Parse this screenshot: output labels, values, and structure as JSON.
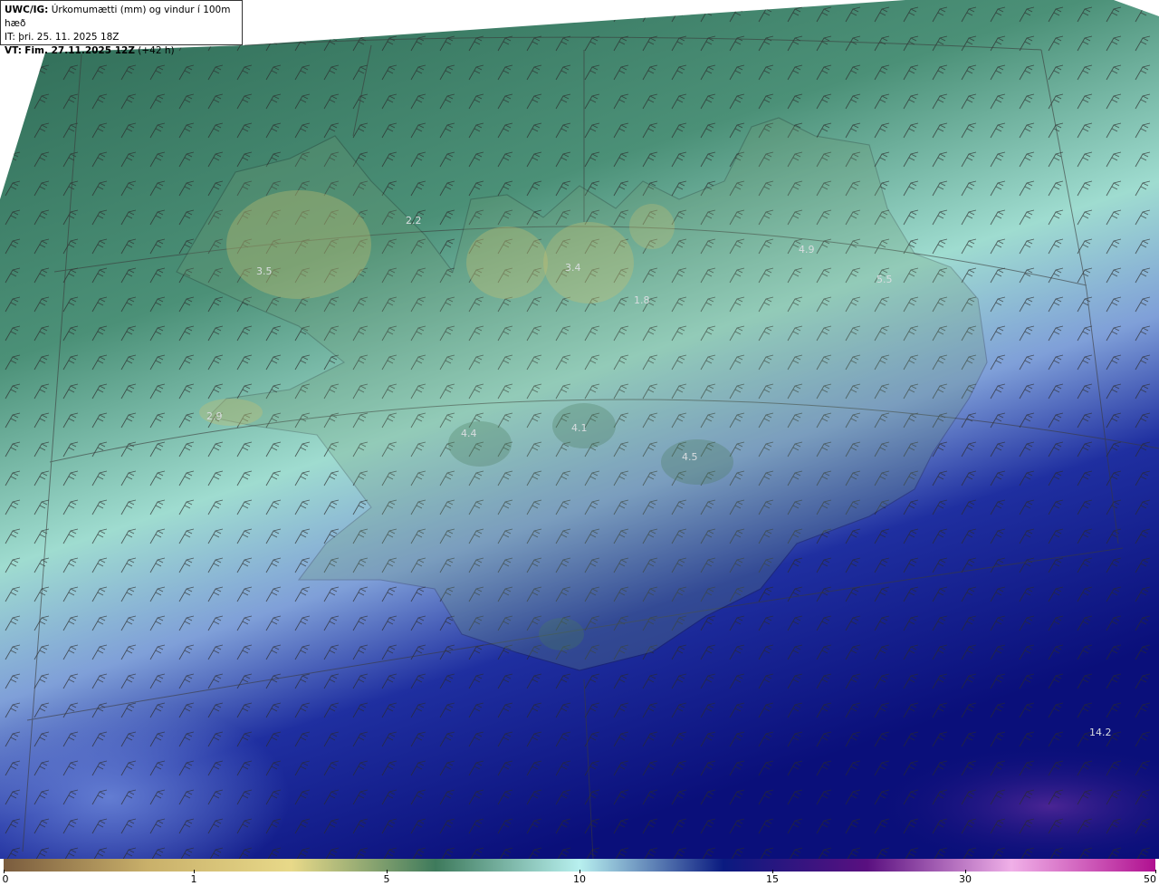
{
  "header": {
    "product_code": "UWC/IG:",
    "product_title": "Úrkomumætti (mm) og vindur í 100m hæð",
    "initial_time": "IT: þri. 25. 11. 2025 18Z",
    "valid_time_prefix": "VT:",
    "valid_time": "Fim. 27.11.2025 12Z",
    "lead_time": "(+42 h)"
  },
  "legend": {
    "ticks": [
      "0",
      "1",
      "5",
      "10",
      "15",
      "30",
      "50"
    ],
    "colors": [
      "#7a5c3e",
      "#c9b06a",
      "#e8d989",
      "#3e7a5c",
      "#b8f0ef",
      "#0a1a80",
      "#5a1080",
      "#f0b0e8",
      "#b01090"
    ]
  },
  "map": {
    "region": "Iceland",
    "values": [
      {
        "label": "3.5"
      },
      {
        "label": "2.2"
      },
      {
        "label": "3.4"
      },
      {
        "label": "1.8"
      },
      {
        "label": "4.9"
      },
      {
        "label": "5.5"
      },
      {
        "label": "2.9"
      },
      {
        "label": "4.4"
      },
      {
        "label": "4.1"
      },
      {
        "label": "4.5"
      },
      {
        "label": "14.2"
      }
    ]
  }
}
